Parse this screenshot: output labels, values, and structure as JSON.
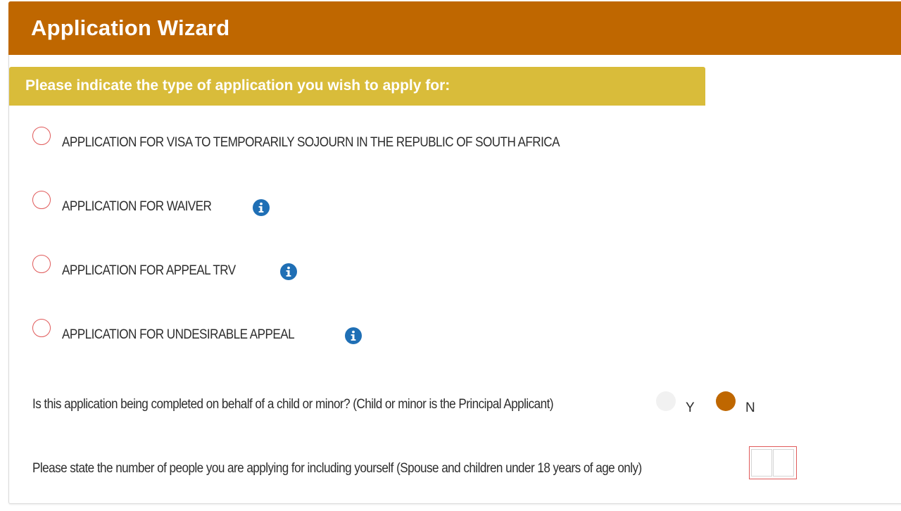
{
  "header": {
    "title": "Application Wizard"
  },
  "section": {
    "title": "Please indicate the type of application you wish to apply for:"
  },
  "options": [
    {
      "label": "APPLICATION FOR VISA TO TEMPORARILY SOJOURN IN THE REPUBLIC OF SOUTH AFRICA",
      "selected": false,
      "has_info": false
    },
    {
      "label": "APPLICATION FOR WAIVER",
      "selected": false,
      "has_info": true
    },
    {
      "label": "APPLICATION FOR APPEAL TRV",
      "selected": false,
      "has_info": true
    },
    {
      "label": "APPLICATION FOR UNDESIRABLE APPEAL",
      "selected": false,
      "has_info": true
    }
  ],
  "minor_question": {
    "text": "Is this application being completed on behalf of a child or minor? (Child or minor is the Principal Applicant)",
    "yes_label": "Y",
    "no_label": "N",
    "selected": "N"
  },
  "people_question": {
    "text": "Please state the number of people you are applying for including yourself (Spouse and children under 18 years of age only)",
    "digit_1": "",
    "digit_2": ""
  },
  "colors": {
    "header_bg": "#bf6700",
    "section_bg": "#d9bc3a",
    "radio_border": "#e05a5a",
    "info_icon": "#1f6fb5",
    "selected_radio": "#bf6700"
  },
  "icons": {
    "info": "info-circle-icon"
  }
}
